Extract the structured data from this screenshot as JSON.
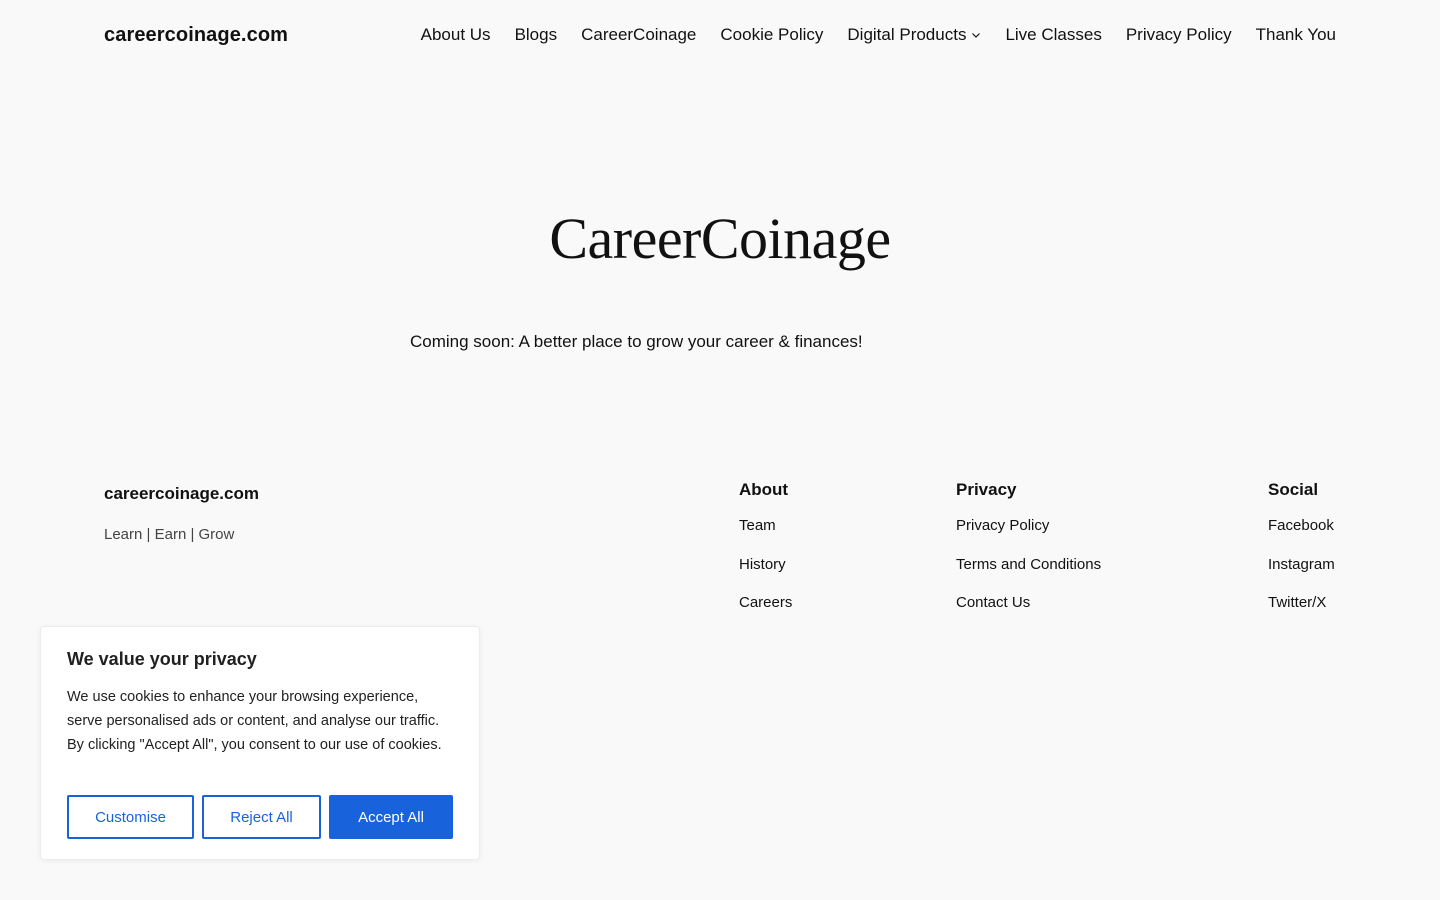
{
  "header": {
    "site_title": "careercoinage.com",
    "nav": [
      {
        "label": "About Us"
      },
      {
        "label": "Blogs"
      },
      {
        "label": "CareerCoinage"
      },
      {
        "label": "Cookie Policy"
      },
      {
        "label": "Digital Products",
        "icon": "chevron-down-icon"
      },
      {
        "label": "Live Classes"
      },
      {
        "label": "Privacy Policy"
      },
      {
        "label": "Thank You"
      }
    ]
  },
  "hero": {
    "title": "CareerCoinage",
    "tagline": "Coming soon: A better place to grow your career & finances!"
  },
  "footer": {
    "site_title": "careercoinage.com",
    "tagline": "Learn | Earn | Grow",
    "columns": [
      {
        "heading": "About",
        "links": [
          "Team",
          "History",
          "Careers"
        ]
      },
      {
        "heading": "Privacy",
        "links": [
          "Privacy Policy",
          "Terms and Conditions",
          "Contact Us"
        ]
      },
      {
        "heading": "Social",
        "links": [
          "Facebook",
          "Instagram",
          "Twitter/X"
        ]
      }
    ]
  },
  "cookie_banner": {
    "title": "We value your privacy",
    "text": "We use cookies to enhance your browsing experience, serve personalised ads or content, and analyse our traffic. By clicking \"Accept All\", you consent to our use of cookies.",
    "customise_label": "Customise",
    "reject_label": "Reject All",
    "accept_label": "Accept All"
  },
  "colors": {
    "background": "#f9f9f9",
    "text": "#111111",
    "accent": "#1863dc"
  }
}
